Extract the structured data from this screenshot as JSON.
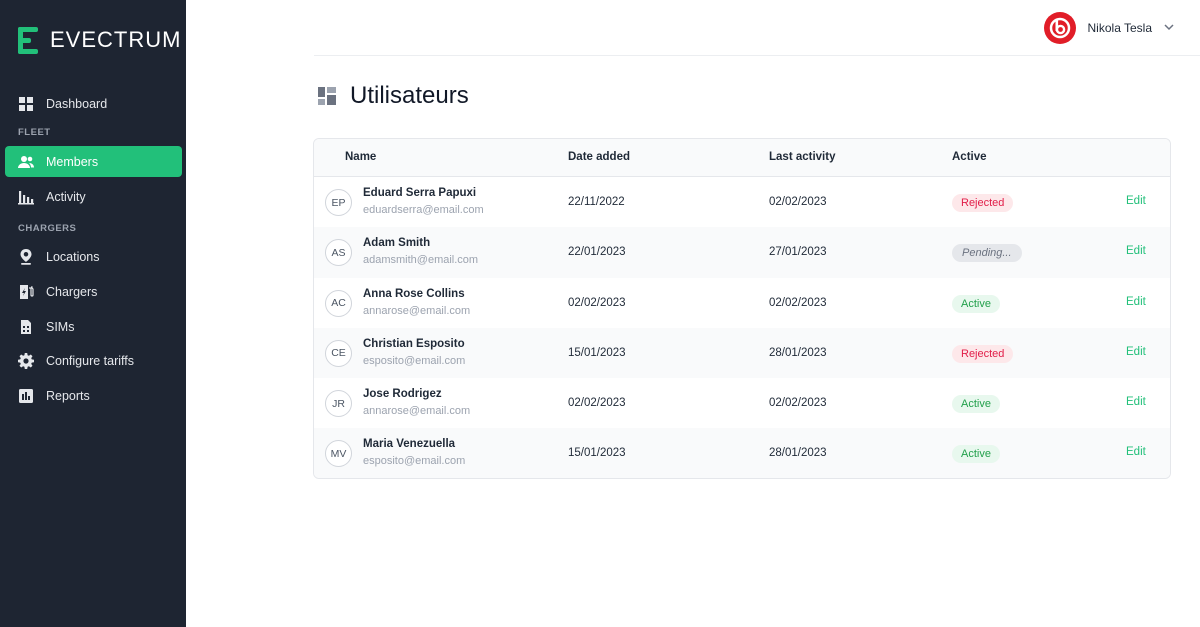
{
  "brand": {
    "name": "EVECTRUM",
    "accent": "#22c07a",
    "sidebar_bg": "#1e2532"
  },
  "sidebar": {
    "sections": {
      "fleet": "FLEET",
      "chargers": "CHARGERS"
    },
    "items": [
      {
        "label": "Dashboard",
        "icon": "dashboard-icon"
      },
      {
        "label": "Members",
        "icon": "members-icon",
        "active": true
      },
      {
        "label": "Activity",
        "icon": "activity-icon"
      },
      {
        "label": "Locations",
        "icon": "location-pin-icon"
      },
      {
        "label": "Chargers",
        "icon": "charger-icon"
      },
      {
        "label": "SIMs",
        "icon": "sim-icon"
      },
      {
        "label": "Configure tariffs",
        "icon": "gear-icon"
      },
      {
        "label": "Reports",
        "icon": "reports-icon"
      }
    ]
  },
  "header": {
    "user_name": "Nikola Tesla",
    "user_logo_color": "#e11d28"
  },
  "page": {
    "title": "Utilisateurs"
  },
  "table": {
    "columns": {
      "name": "Name",
      "date_added": "Date added",
      "last_activity": "Last activity",
      "active": "Active"
    },
    "edit_label": "Edit",
    "rows": [
      {
        "initials": "EP",
        "name": "Eduard Serra Papuxi",
        "email": "eduardserra@email.com",
        "date_added": "22/11/2022",
        "last_activity": "02/02/2023",
        "status": "Rejected",
        "status_type": "rejected"
      },
      {
        "initials": "AS",
        "name": "Adam Smith",
        "email": "adamsmith@email.com",
        "date_added": "22/01/2023",
        "last_activity": "27/01/2023",
        "status": "Pending...",
        "status_type": "pending"
      },
      {
        "initials": "AC",
        "name": "Anna Rose Collins",
        "email": "annarose@email.com",
        "date_added": "02/02/2023",
        "last_activity": "02/02/2023",
        "status": "Active",
        "status_type": "active"
      },
      {
        "initials": "CE",
        "name": "Christian Esposito",
        "email": "esposito@email.com",
        "date_added": "15/01/2023",
        "last_activity": "28/01/2023",
        "status": "Rejected",
        "status_type": "rejected"
      },
      {
        "initials": "JR",
        "name": "Jose Rodrigez",
        "email": "annarose@email.com",
        "date_added": "02/02/2023",
        "last_activity": "02/02/2023",
        "status": "Active",
        "status_type": "active"
      },
      {
        "initials": "MV",
        "name": "Maria Venezuella",
        "email": "esposito@email.com",
        "date_added": "15/01/2023",
        "last_activity": "28/01/2023",
        "status": "Active",
        "status_type": "active"
      }
    ]
  }
}
